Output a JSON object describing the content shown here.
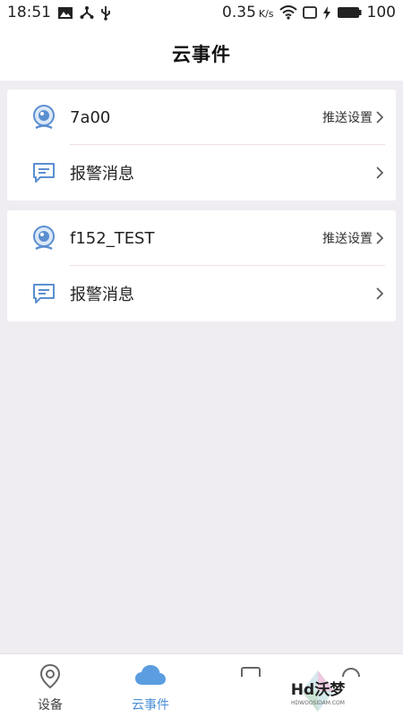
{
  "status_bar": {
    "time": "18:51",
    "speed": "0.35",
    "speed_unit": "K/s",
    "battery": "100"
  },
  "header": {
    "title": "云事件"
  },
  "devices": [
    {
      "name": "7a00",
      "push_label": "推送设置",
      "alarm_label": "报警消息"
    },
    {
      "name": "f152_TEST",
      "push_label": "推送设置",
      "alarm_label": "报警消息"
    }
  ],
  "tabbar": {
    "tabs": [
      {
        "label": "设备",
        "active": false
      },
      {
        "label": "云事件",
        "active": true
      }
    ]
  },
  "watermark": {
    "text": "Hd沃梦",
    "subtext": "HDWOOSIDAM.COM"
  },
  "colors": {
    "accent": "#4a8fd8",
    "background": "#efedf1",
    "icon_blue": "#5b8fd0"
  }
}
